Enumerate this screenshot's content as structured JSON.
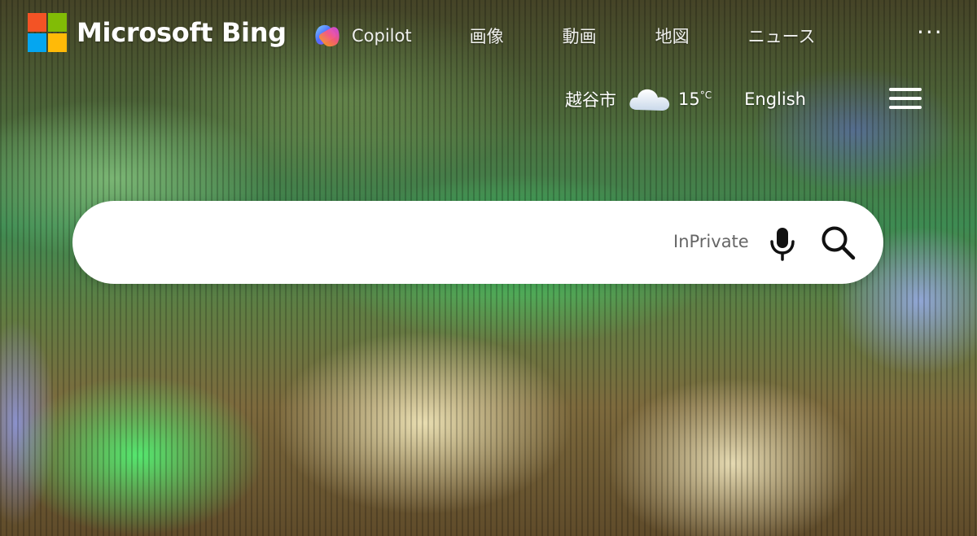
{
  "header": {
    "brand": "Microsoft Bing",
    "logo_colors": [
      "#F35325",
      "#81BC06",
      "#05A6F0",
      "#FFBA08"
    ],
    "nav": {
      "copilot": "Copilot",
      "images": "画像",
      "videos": "動画",
      "maps": "地図",
      "news": "ニュース"
    },
    "more_icon": "more-dots-icon"
  },
  "weather": {
    "location": "越谷市",
    "icon": "cloud-icon",
    "temperature": "15",
    "unit": "°C"
  },
  "language_link": "English",
  "menu_icon": "hamburger-menu-icon",
  "search": {
    "placeholder": "",
    "value": "",
    "inprivate_label": "InPrivate",
    "mic_icon": "microphone-icon",
    "search_icon": "search-icon"
  }
}
